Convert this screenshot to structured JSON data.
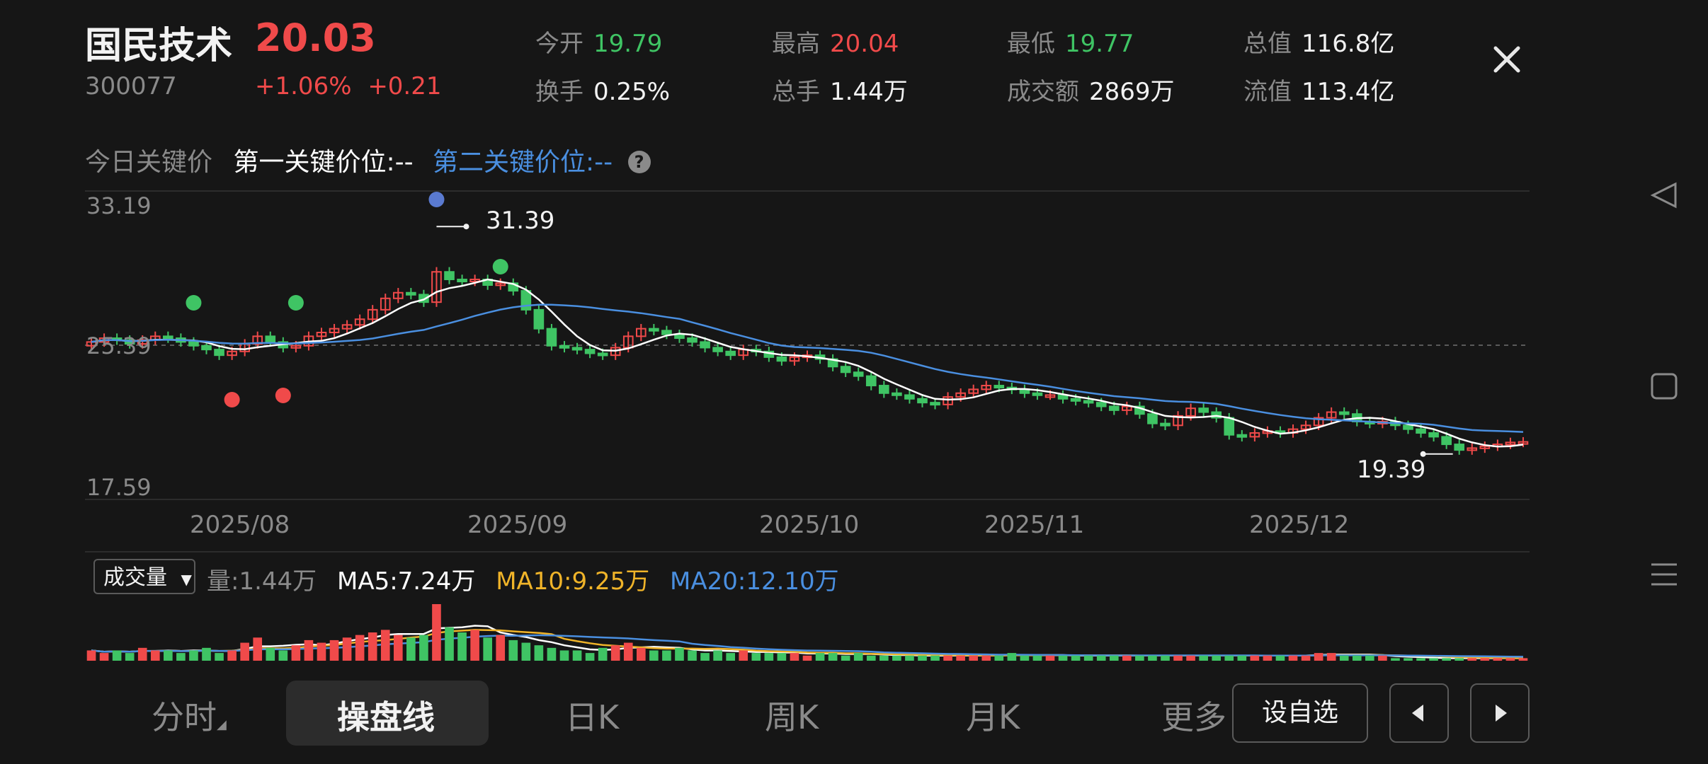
{
  "stock": {
    "name": "国民技术",
    "price": "20.03",
    "code": "300077",
    "change_pct": "+1.06%",
    "change_abs": "+0.21"
  },
  "stats": [
    {
      "label": "今开",
      "value": "19.79",
      "color": "green"
    },
    {
      "label": "最高",
      "value": "20.04",
      "color": "red"
    },
    {
      "label": "最低",
      "value": "19.77",
      "color": "green"
    },
    {
      "label": "总值",
      "value": "116.8亿",
      "color": "white"
    },
    {
      "label": "换手",
      "value": "0.25%",
      "color": "white"
    },
    {
      "label": "总手",
      "value": "1.44万",
      "color": "white"
    },
    {
      "label": "成交额",
      "value": "2869万",
      "color": "white"
    },
    {
      "label": "流值",
      "value": "113.4亿",
      "color": "white"
    }
  ],
  "key_price": {
    "label": "今日关键价",
    "first": "第一关键价位:--",
    "second": "第二关键价位:--",
    "help": "?"
  },
  "close_icon": "close-icon",
  "chart": {
    "y_top": "33.19",
    "y_mid": "25.39",
    "y_bottom": "17.59",
    "high_label": "31.39",
    "low_label": "19.39",
    "months": [
      "2025/08",
      "2025/09",
      "2025/10",
      "2025/11",
      "2025/12"
    ]
  },
  "volume": {
    "selector": "成交量",
    "vol": "量:1.44万",
    "ma5": "MA5:7.24万",
    "ma10": "MA10:9.25万",
    "ma20": "MA20:12.10万"
  },
  "tabs": [
    "分时",
    "操盘线",
    "日K",
    "周K",
    "月K",
    "更多"
  ],
  "buttons": {
    "watchlist": "设自选"
  },
  "colors": {
    "up": "#f04a4a",
    "down": "#3fc464",
    "ma_white": "#ffffff",
    "ma_blue": "#4a8fe0",
    "ma_yellow": "#f0b429"
  },
  "chart_data": {
    "type": "candlestick",
    "y_range": [
      17.59,
      33.19
    ],
    "x_range_labels": [
      "2025/08",
      "2025/09",
      "2025/10",
      "2025/11",
      "2025/12"
    ],
    "price_high_marker": 31.39,
    "price_low_marker": 19.39,
    "close_series": [
      25.3,
      25.5,
      25.4,
      25.2,
      25.4,
      25.6,
      25.5,
      25.3,
      25.1,
      24.9,
      24.6,
      24.8,
      25.2,
      25.6,
      25.3,
      25.0,
      25.1,
      25.6,
      25.8,
      26.0,
      26.2,
      26.5,
      27.0,
      27.6,
      27.9,
      27.8,
      27.4,
      29.0,
      28.6,
      28.5,
      28.6,
      28.3,
      28.4,
      28.0,
      27.0,
      26.0,
      25.1,
      25.0,
      24.9,
      24.7,
      24.6,
      25.0,
      25.6,
      26.0,
      25.9,
      25.7,
      25.5,
      25.3,
      25.0,
      24.8,
      24.6,
      24.9,
      24.8,
      24.5,
      24.3,
      24.5,
      24.6,
      24.4,
      24.0,
      23.7,
      23.5,
      23.0,
      22.6,
      22.5,
      22.3,
      22.1,
      22.0,
      22.4,
      22.6,
      22.8,
      23.0,
      22.9,
      22.8,
      22.6,
      22.5,
      22.5,
      22.3,
      22.2,
      22.1,
      21.9,
      21.7,
      21.9,
      21.5,
      21.0,
      20.9,
      21.4,
      21.8,
      21.6,
      21.3,
      20.4,
      20.3,
      20.5,
      20.6,
      20.5,
      20.7,
      20.9,
      21.3,
      21.6,
      21.5,
      21.1,
      21.0,
      21.1,
      20.9,
      20.7,
      20.5,
      20.3,
      19.9,
      19.6,
      19.7,
      19.8,
      19.9,
      20.0,
      20.03
    ],
    "volume_relative": [
      0.4,
      0.3,
      0.4,
      0.3,
      0.5,
      0.4,
      0.4,
      0.3,
      0.4,
      0.5,
      0.3,
      0.4,
      0.7,
      0.9,
      0.5,
      0.4,
      0.6,
      0.8,
      0.7,
      0.8,
      0.9,
      1.0,
      1.1,
      1.2,
      1.0,
      0.9,
      1.0,
      2.2,
      1.3,
      1.1,
      1.2,
      0.9,
      1.0,
      0.8,
      0.7,
      0.6,
      0.5,
      0.4,
      0.4,
      0.3,
      0.5,
      0.6,
      0.7,
      0.5,
      0.4,
      0.4,
      0.5,
      0.4,
      0.3,
      0.4,
      0.3,
      0.4,
      0.3,
      0.3,
      0.3,
      0.3,
      0.2,
      0.3,
      0.3,
      0.2,
      0.3,
      0.2,
      0.2,
      0.2,
      0.2,
      0.2,
      0.2,
      0.2,
      0.2,
      0.2,
      0.2,
      0.2,
      0.3,
      0.2,
      0.2,
      0.2,
      0.2,
      0.2,
      0.2,
      0.2,
      0.2,
      0.2,
      0.2,
      0.2,
      0.2,
      0.2,
      0.2,
      0.2,
      0.2,
      0.2,
      0.2,
      0.2,
      0.2,
      0.2,
      0.2,
      0.2,
      0.3,
      0.3,
      0.2,
      0.2,
      0.2,
      0.2,
      0.1,
      0.1,
      0.1,
      0.1,
      0.1,
      0.1,
      0.1,
      0.1,
      0.1,
      0.1,
      0.1
    ]
  }
}
